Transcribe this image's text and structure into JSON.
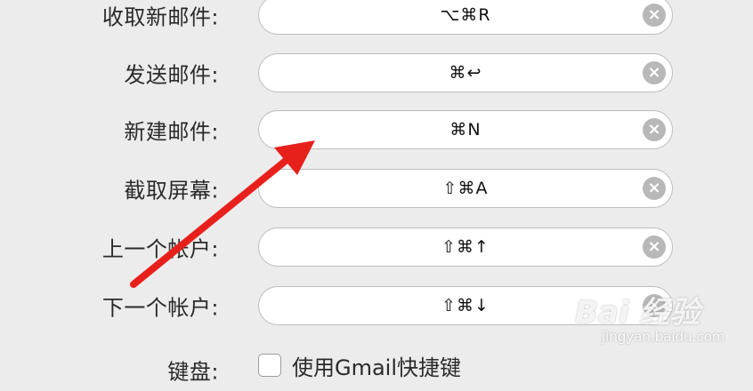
{
  "shortcuts": [
    {
      "label": "收取新邮件:",
      "keys": "⌥⌘R"
    },
    {
      "label": "发送邮件:",
      "keys": "⌘↩"
    },
    {
      "label": "新建邮件:",
      "keys": "⌘N"
    },
    {
      "label": "截取屏幕:",
      "keys": "⇧⌘A"
    },
    {
      "label": "上一个帐户:",
      "keys": "⇧⌘↑"
    },
    {
      "label": "下一个帐户:",
      "keys": "⇧⌘↓"
    }
  ],
  "clear_symbol": "×",
  "keyboard": {
    "label": "键盘:",
    "checkbox_label": "使用Gmail快捷键",
    "checked": false
  },
  "watermark": {
    "logo": "Bai 经验",
    "url": "jingyan.baidu.com"
  },
  "colors": {
    "annotation_arrow": "#e8201c",
    "background": "#ececec",
    "field_bg": "#ffffff",
    "clear_button": "#b8b8b8"
  }
}
